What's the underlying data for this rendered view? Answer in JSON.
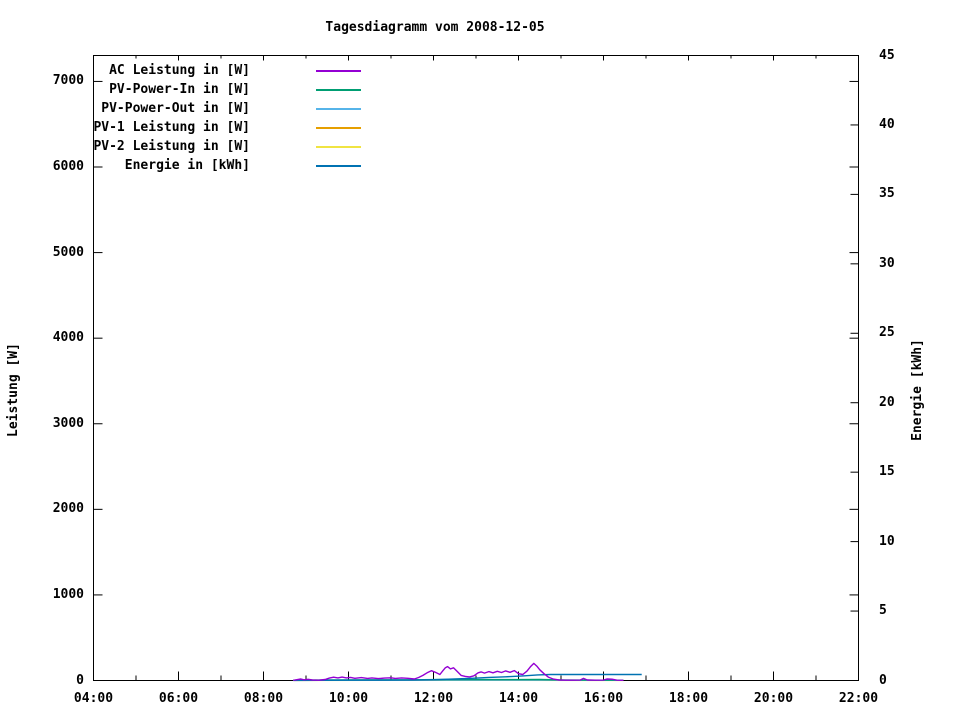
{
  "title": "Tagesdiagramm vom 2008-12-05",
  "y1_axis_label": "Leistung [W]",
  "y2_axis_label": "Energie [kWh]",
  "chart_data": {
    "type": "line",
    "title": "Tagesdiagramm vom 2008-12-05",
    "grid": false,
    "legend_position": "top-left-inside",
    "x_axis": {
      "unit": "hour-of-day",
      "range": [
        4,
        22
      ],
      "major_tick_step_hours": 2,
      "minor_tick_step_hours": 1,
      "tick_labels": [
        "04:00",
        "06:00",
        "08:00",
        "10:00",
        "12:00",
        "14:00",
        "16:00",
        "18:00",
        "20:00",
        "22:00"
      ]
    },
    "y1_axis": {
      "label": "Leistung [W]",
      "range": [
        0,
        7303
      ],
      "tick_step": 1000,
      "tick_labels": [
        "0",
        "1000",
        "2000",
        "3000",
        "4000",
        "5000",
        "6000",
        "7000"
      ]
    },
    "y2_axis": {
      "label": "Energie [kWh]",
      "range": [
        0,
        45
      ],
      "tick_step": 5,
      "tick_labels": [
        "0",
        "5",
        "10",
        "15",
        "20",
        "25",
        "30",
        "35",
        "40",
        "45"
      ]
    },
    "series": [
      {
        "name": "AC Leistung in [W]",
        "color": "#9400D3",
        "axis": "y1",
        "points": [
          [
            8.7,
            2
          ],
          [
            8.8,
            10
          ],
          [
            8.88,
            18
          ],
          [
            8.95,
            8
          ],
          [
            9.05,
            14
          ],
          [
            9.15,
            6
          ],
          [
            9.3,
            4
          ],
          [
            9.45,
            12
          ],
          [
            9.55,
            28
          ],
          [
            9.65,
            38
          ],
          [
            9.75,
            30
          ],
          [
            9.85,
            40
          ],
          [
            9.95,
            30
          ],
          [
            10.05,
            36
          ],
          [
            10.15,
            26
          ],
          [
            10.3,
            34
          ],
          [
            10.45,
            24
          ],
          [
            10.55,
            30
          ],
          [
            10.7,
            22
          ],
          [
            10.85,
            28
          ],
          [
            11.0,
            32
          ],
          [
            11.1,
            24
          ],
          [
            11.25,
            30
          ],
          [
            11.4,
            26
          ],
          [
            11.55,
            18
          ],
          [
            11.65,
            35
          ],
          [
            11.75,
            60
          ],
          [
            11.85,
            90
          ],
          [
            11.95,
            115
          ],
          [
            12.05,
            95
          ],
          [
            12.15,
            70
          ],
          [
            12.22,
            115
          ],
          [
            12.28,
            150
          ],
          [
            12.33,
            162
          ],
          [
            12.4,
            135
          ],
          [
            12.47,
            148
          ],
          [
            12.55,
            110
          ],
          [
            12.65,
            60
          ],
          [
            12.75,
            48
          ],
          [
            12.85,
            42
          ],
          [
            12.95,
            55
          ],
          [
            13.05,
            90
          ],
          [
            13.12,
            100
          ],
          [
            13.2,
            86
          ],
          [
            13.3,
            104
          ],
          [
            13.4,
            90
          ],
          [
            13.5,
            108
          ],
          [
            13.6,
            94
          ],
          [
            13.7,
            112
          ],
          [
            13.8,
            96
          ],
          [
            13.9,
            116
          ],
          [
            14.0,
            80
          ],
          [
            14.1,
            70
          ],
          [
            14.2,
            110
          ],
          [
            14.28,
            160
          ],
          [
            14.36,
            200
          ],
          [
            14.43,
            168
          ],
          [
            14.5,
            125
          ],
          [
            14.6,
            80
          ],
          [
            14.7,
            40
          ],
          [
            14.82,
            16
          ],
          [
            14.95,
            6
          ],
          [
            15.1,
            3
          ],
          [
            15.3,
            4
          ],
          [
            15.45,
            5
          ],
          [
            15.53,
            24
          ],
          [
            15.62,
            6
          ],
          [
            15.8,
            4
          ],
          [
            16.0,
            5
          ],
          [
            16.08,
            18
          ],
          [
            16.2,
            15
          ],
          [
            16.32,
            4
          ],
          [
            16.47,
            2
          ]
        ]
      },
      {
        "name": "PV-Power-In in [W]",
        "color": "#009E73",
        "axis": "y1",
        "points": [
          [
            8.7,
            4
          ],
          [
            9.5,
            7
          ],
          [
            10.5,
            8
          ],
          [
            11.5,
            8
          ],
          [
            12.3,
            12
          ],
          [
            13.0,
            11
          ],
          [
            14.0,
            11
          ],
          [
            14.5,
            12
          ],
          [
            15.0,
            7
          ],
          [
            15.5,
            5
          ],
          [
            16.0,
            4
          ],
          [
            16.47,
            3
          ]
        ]
      },
      {
        "name": "PV-Power-Out in [W]",
        "color": "#56B4E9",
        "axis": "y1",
        "points": [
          [
            8.7,
            2
          ],
          [
            11.0,
            3
          ],
          [
            13.0,
            4
          ],
          [
            15.0,
            3
          ],
          [
            16.47,
            2
          ]
        ]
      },
      {
        "name": "PV-1 Leistung in [W]",
        "color": "#E69F00",
        "axis": "y1",
        "points": [
          [
            8.7,
            2
          ],
          [
            12.5,
            3
          ],
          [
            16.47,
            2
          ]
        ]
      },
      {
        "name": "PV-2 Leistung in [W]",
        "color": "#F0E442",
        "axis": "y1",
        "points": [
          [
            8.7,
            1
          ],
          [
            12.5,
            2
          ],
          [
            16.47,
            1
          ]
        ]
      },
      {
        "name": "Energie in [kWh]",
        "color": "#0072B2",
        "axis": "y2",
        "points": [
          [
            8.7,
            0.01
          ],
          [
            10.0,
            0.02
          ],
          [
            11.5,
            0.03
          ],
          [
            11.9,
            0.05
          ],
          [
            12.2,
            0.08
          ],
          [
            12.5,
            0.11
          ],
          [
            12.9,
            0.16
          ],
          [
            13.3,
            0.22
          ],
          [
            13.7,
            0.27
          ],
          [
            14.1,
            0.33
          ],
          [
            14.45,
            0.4
          ],
          [
            14.75,
            0.43
          ],
          [
            16.9,
            0.43
          ]
        ]
      }
    ]
  }
}
